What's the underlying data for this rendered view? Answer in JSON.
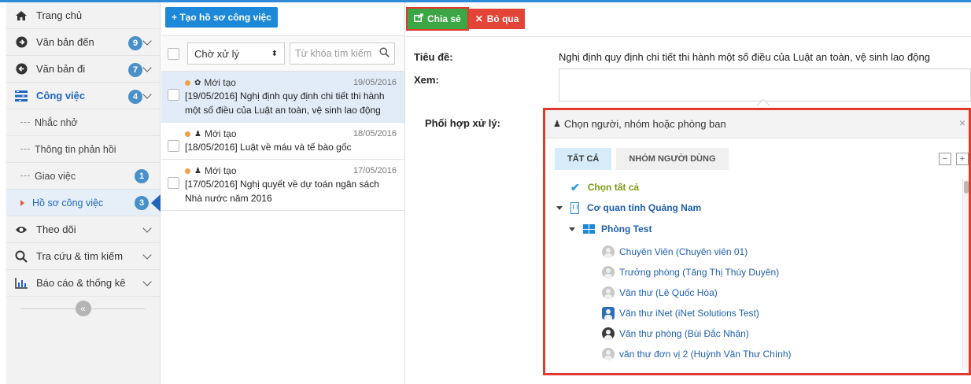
{
  "sidebar": {
    "items": [
      {
        "label": "Trang chủ",
        "icon": "home-icon"
      },
      {
        "label": "Văn bản đến",
        "icon": "arrow-right-circle-icon",
        "badge": "9"
      },
      {
        "label": "Văn bản đi",
        "icon": "arrow-left-circle-icon",
        "badge": "7"
      },
      {
        "label": "Công việc",
        "icon": "tasks-icon",
        "badge": "4"
      }
    ],
    "sub_items": [
      {
        "label": "Nhắc nhở"
      },
      {
        "label": "Thông tin phản hồi"
      },
      {
        "label": "Giao việc",
        "badge": "1"
      },
      {
        "label": "Hồ sơ công việc",
        "badge": "3"
      }
    ],
    "bottom_items": [
      {
        "label": "Theo dõi",
        "icon": "eye-icon"
      },
      {
        "label": "Tra cứu & tìm kiếm",
        "icon": "search-icon"
      },
      {
        "label": "Báo cáo & thống kê",
        "icon": "bar-chart-icon"
      }
    ],
    "collapse_glyph": "«"
  },
  "middle": {
    "create_button": "+ Tạo hồ sơ công việc",
    "filter_value": "Chờ xử lý",
    "search_placeholder": "Từ khóa tìm kiếm",
    "tasks": [
      {
        "status": "Mới tạo",
        "date": "19/05/2016",
        "title": "[19/05/2016] Nghị định quy định chi tiết thi hành một số điều của Luật an toàn, vệ sinh lao động"
      },
      {
        "status": "Mới tạo",
        "date": "18/05/2016",
        "title": "[18/05/2016] Luật về máu và tế bào gốc"
      },
      {
        "status": "Mới tạo",
        "date": "17/05/2016",
        "title": "[17/05/2016] Nghị quyết về dự toán ngân sách Nhà nước năm 2016"
      }
    ]
  },
  "detail": {
    "share_button": "Chia sẻ",
    "skip_button": "Bỏ qua",
    "title_label": "Tiêu đề:",
    "title_value": "Nghị định quy định chi tiết thi hành một số điều của Luật an toàn, vệ sinh lao động",
    "view_label": "Xem:",
    "coord_label": "Phối hợp xử lý:"
  },
  "picker": {
    "heading": "Chọn người, nhóm hoặc phòng ban",
    "tab_all": "TẤT CẢ",
    "tab_groups": "NHÓM NGƯỜI DÙNG",
    "select_all": "Chọn tất cả",
    "org": "Cơ quan tỉnh Quảng Nam",
    "dept": "Phòng Test",
    "users": [
      "Chuyên Viên (Chuyên viên 01)",
      "Trưởng phòng (Tăng Thị Thúy Duyên)",
      "Văn thư (Lê Quốc Hòa)",
      "Văn thư iNet (iNet Solutions Test)",
      "Văn thư phòng (Bùi Đắc Nhân)",
      "văn thư đơn vị 2 (Huỳnh Văn Thư Chính)"
    ]
  },
  "colors": {
    "accent": "#1e88d8",
    "share_green": "#3aa744",
    "skip_red": "#e24437",
    "badge": "#4a90c8",
    "status_dot": "#f0a04b"
  }
}
